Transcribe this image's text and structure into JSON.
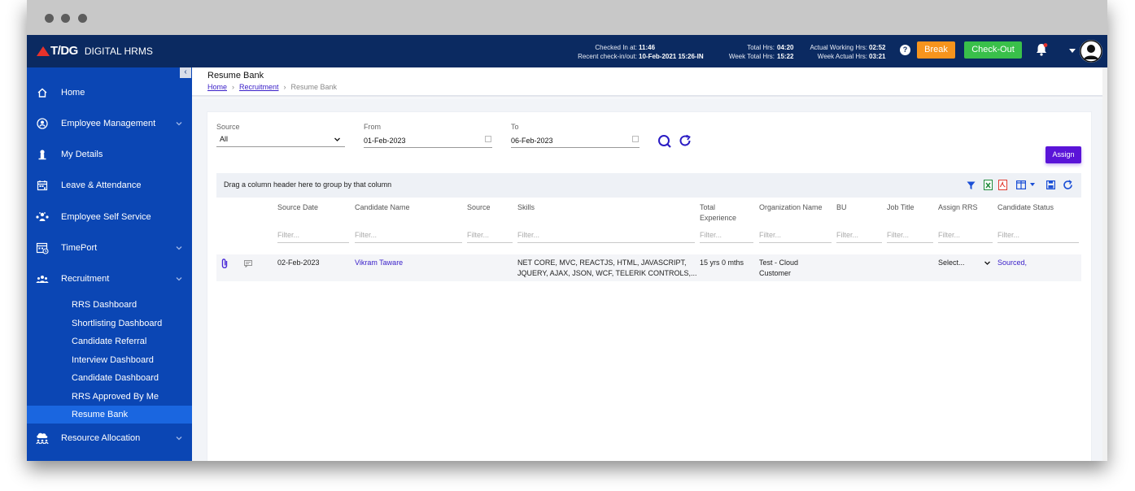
{
  "app": {
    "brand": "T/DG",
    "name": "DIGITAL HRMS"
  },
  "topbar": {
    "checked_in_label": "Checked In at:",
    "checked_in_value": "11:46",
    "recent_label": "Recent check-in/out:",
    "recent_value": "10-Feb-2021 15:26-IN",
    "total_hrs_label": "Total Hrs:",
    "total_hrs_value": "04:20",
    "week_total_label": "Week Total Hrs:",
    "week_total_value": "15:22",
    "actual_working_label": "Actual Working Hrs:",
    "actual_working_value": "02:52",
    "week_actual_label": "Week Actual Hrs:",
    "week_actual_value": "03:21",
    "help": "?",
    "break_label": "Break",
    "checkout_label": "Check-Out"
  },
  "sidebar": {
    "collapse": "‹",
    "items": [
      {
        "label": "Home",
        "icon": "home-icon"
      },
      {
        "label": "Employee Management",
        "icon": "employee-icon"
      },
      {
        "label": "My Details",
        "icon": "person-icon"
      },
      {
        "label": "Leave & Attendance",
        "icon": "calendar-icon"
      },
      {
        "label": "Employee Self Service",
        "icon": "self-service-icon"
      },
      {
        "label": "TimePort",
        "icon": "timeport-icon"
      },
      {
        "label": "Recruitment",
        "icon": "recruitment-icon"
      },
      {
        "label": "Resource Allocation",
        "icon": "resource-icon"
      }
    ],
    "recruitment_sub": [
      "RRS Dashboard",
      "Shortlisting Dashboard",
      "Candidate Referral",
      "Interview Dashboard",
      "Candidate Dashboard",
      "RRS Approved By Me",
      "Resume Bank"
    ]
  },
  "page": {
    "title": "Resume Bank",
    "breadcrumb": [
      "Home",
      "Recruitment",
      "Resume Bank"
    ]
  },
  "filters": {
    "source_label": "Source",
    "source_value": "All",
    "from_label": "From",
    "from_value": "01-Feb-2023",
    "to_label": "To",
    "to_value": "06-Feb-2023",
    "assign_label": "Assign"
  },
  "grid": {
    "group_hint": "Drag a column header here to group by that column",
    "columns": [
      "Source Date",
      "Candidate Name",
      "Source",
      "Skills",
      "Total Experience",
      "Organization Name",
      "BU",
      "Job Title",
      "Assign RRS",
      "Candidate Status"
    ],
    "filter_placeholder": "Filter...",
    "rows": [
      {
        "source_date": "02-Feb-2023",
        "candidate_name": "Vikram Taware",
        "source": "",
        "skills_line1": "NET CORE, MVC, REACTJS, HTML, JAVASCRIPT,",
        "skills_line2": "JQUERY, AJAX, JSON, WCF, TELERIK CONTROLS,...",
        "total_experience": "15 yrs 0 mths",
        "org_line1": "Test - Cloud",
        "org_line2": "Customer",
        "bu": "",
        "job_title": "",
        "assign_rrs": "Select...",
        "status": "Sourced,"
      }
    ]
  },
  "colors": {
    "topbar": "#0b2a61",
    "sidebar": "#0b46b4",
    "sidebar_active": "#1a66e0",
    "accent": "#5a14d8",
    "break": "#f7941d",
    "checkout": "#39c04a"
  }
}
